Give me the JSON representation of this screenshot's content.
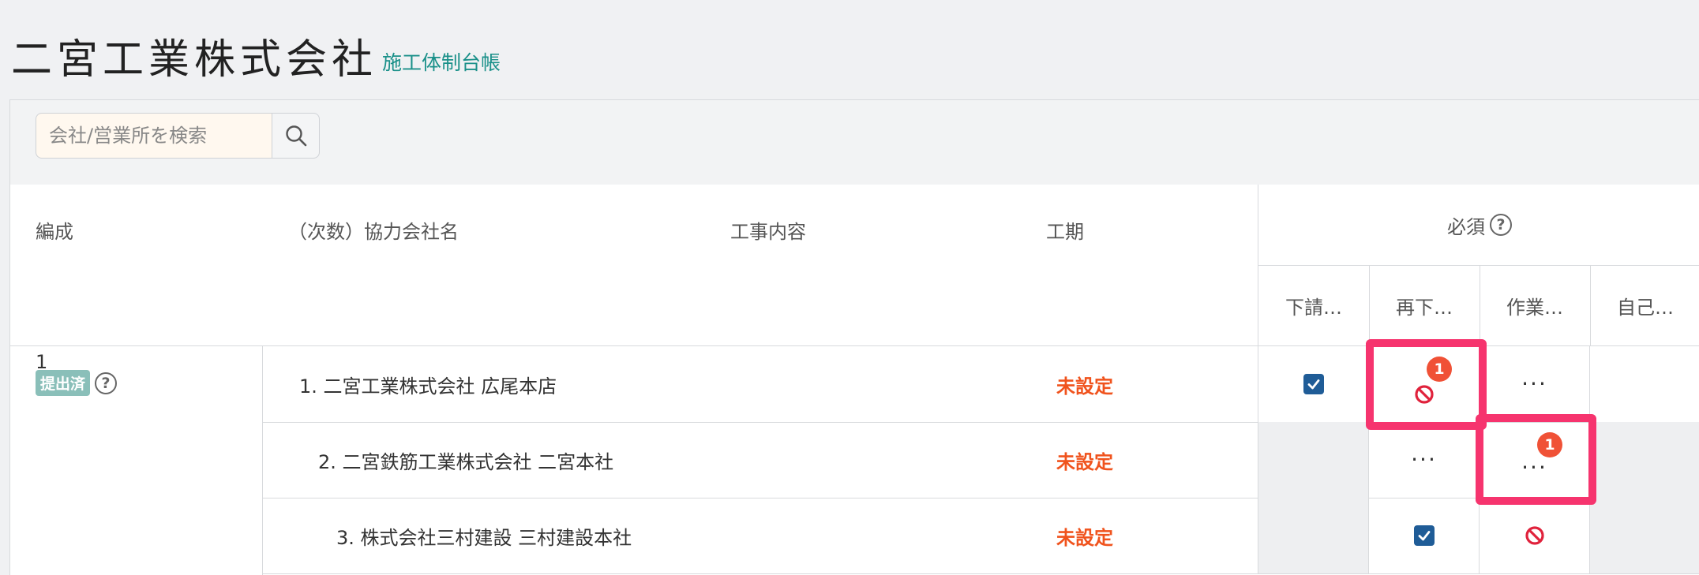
{
  "header": {
    "title": "二宮工業株式会社",
    "subtitle": "施工体制台帳"
  },
  "search": {
    "placeholder": "会社/営業所を検索"
  },
  "table": {
    "columns": {
      "hensei": "編成",
      "company": "（次数）協力会社名",
      "work": "工事内容",
      "period": "工期",
      "required": "必須"
    },
    "required_subcolumns": [
      "下請…",
      "再下…",
      "作業…",
      "自己…"
    ],
    "group": {
      "number": "1",
      "status": "提出済"
    },
    "rows": [
      {
        "company": "1. 二宮工業株式会社 広尾本店",
        "period": "未設定",
        "badge_a": "1"
      },
      {
        "company": "2. 二宮鉄筋工業株式会社 二宮本社",
        "period": "未設定",
        "badge_b": "1"
      },
      {
        "company": "3. 株式会社三村建設 三村建設本社",
        "period": "未設定"
      }
    ]
  },
  "colors": {
    "accent": "#1a9089",
    "warning": "#f0531d",
    "highlight": "#f6346e",
    "check": "#1f5c97",
    "blocked": "#e0223c"
  }
}
